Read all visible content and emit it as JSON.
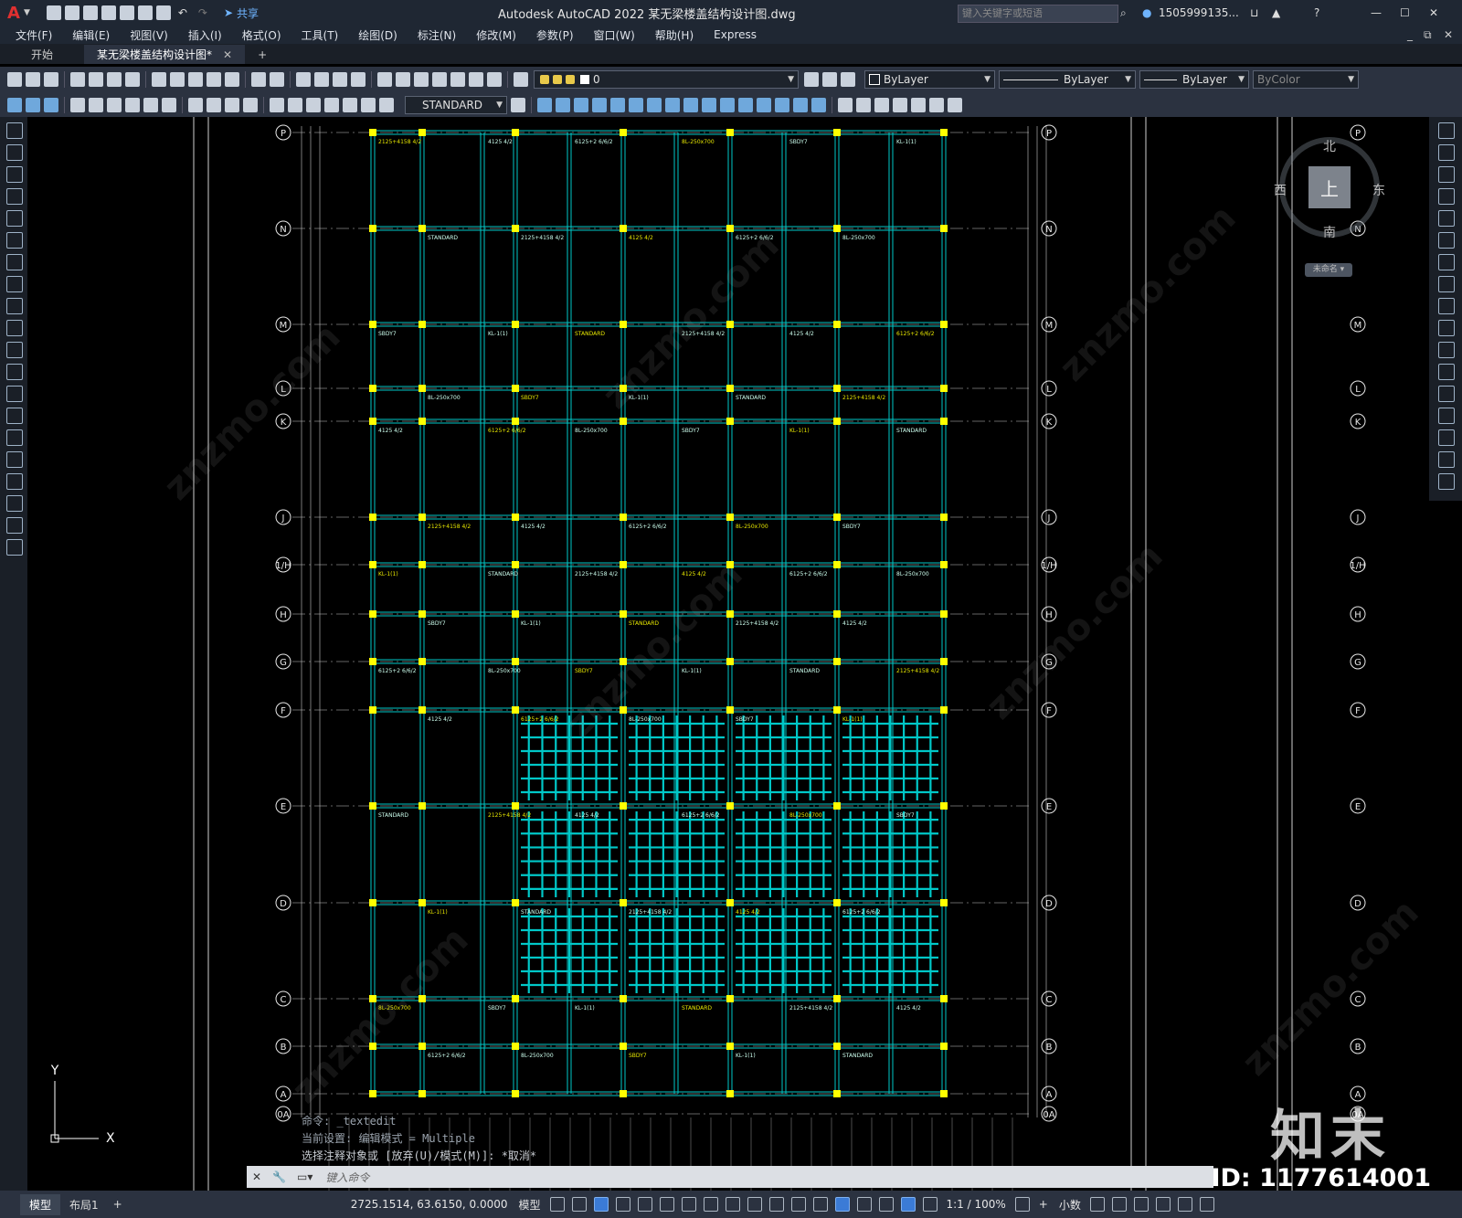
{
  "app": {
    "title": "Autodesk AutoCAD 2022    某无梁楼盖结构设计图.dwg",
    "share_label": "共享",
    "search_placeholder": "键入关键字或短语",
    "user": "1505999135...",
    "logo": "A"
  },
  "menu": [
    "文件(F)",
    "编辑(E)",
    "视图(V)",
    "插入(I)",
    "格式(O)",
    "工具(T)",
    "绘图(D)",
    "标注(N)",
    "修改(M)",
    "参数(P)",
    "窗口(W)",
    "帮助(H)",
    "Express"
  ],
  "tabs": [
    {
      "label": "开始"
    },
    {
      "label": "某无梁楼盖结构设计图*"
    }
  ],
  "toolbar": {
    "layer_value": "0",
    "color_value": "ByLayer",
    "linetype_value": "ByLayer",
    "lineweight_value": "ByLayer",
    "plotstyle_value": "ByColor",
    "textstyle_value": "STANDARD"
  },
  "viewcube": {
    "north": "北",
    "south": "南",
    "east": "东",
    "west": "西",
    "top": "上",
    "ucs_label": "未命名"
  },
  "drawing": {
    "grid_rows": [
      "P",
      "N",
      "M",
      "L",
      "K",
      "J",
      "1/H",
      "H",
      "G",
      "F",
      "E",
      "D",
      "C",
      "B",
      "A",
      "0A"
    ],
    "ucs_y": "Y",
    "ucs_x": "X",
    "sample_labels": [
      "2125+4158 4/2",
      "4125 4/2",
      "6125+2 6/6/2",
      "8L-250x700",
      "SBDY7",
      "KL-1(1)",
      "STANDARD"
    ]
  },
  "command": {
    "history": [
      "命令: _textedit",
      "当前设置: 编辑模式 = Multiple",
      "选择注释对象或 [放弃(U)/模式(M)]: *取消*"
    ],
    "input_placeholder": "键入命令"
  },
  "layout_tabs": [
    {
      "label": "模型"
    },
    {
      "label": "布局1"
    }
  ],
  "status": {
    "coords": "2725.1514, 63.6150, 0.0000",
    "model_label": "模型",
    "scale": "1:1 / 100%",
    "units": "小数"
  },
  "watermark": {
    "brand": "知末",
    "id": "ID: 1177614001",
    "site": "znzmo.com"
  },
  "colors": {
    "background": "#000000",
    "beam": "#00c8c8",
    "column": "#ffff00",
    "text_yellow": "#e8e800",
    "grid_circle": "#ffffff",
    "accent": "#3b7bd6"
  }
}
